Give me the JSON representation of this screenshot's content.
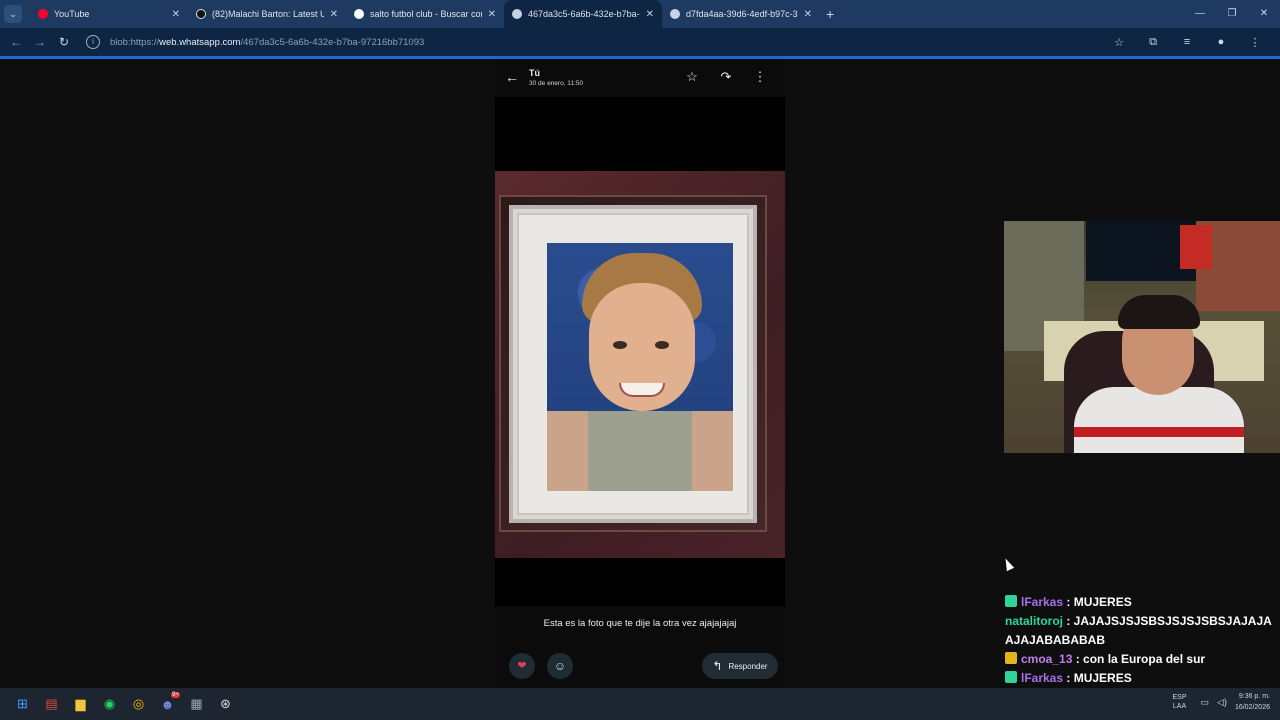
{
  "browser": {
    "tabs": [
      {
        "title": "YouTube",
        "favicon_color": "#ff0033",
        "active": false
      },
      {
        "title": "(82)Malachi Barton: Latest Upd",
        "favicon_color": "#111111",
        "active": false
      },
      {
        "title": "salto futbol club - Buscar con G",
        "favicon_color": "#ffffff",
        "active": false
      },
      {
        "title": "467da3c5-6a6b-432e-b7ba-97",
        "favicon_color": "#c7d3e3",
        "active": true
      },
      {
        "title": "d7fda4aa-39d6-4edf-b97c-37b",
        "favicon_color": "#c7d3e3",
        "active": false
      }
    ],
    "new_tab_icon": "+",
    "url_prefix": "blob:https://",
    "url_host": "web.whatsapp.com",
    "url_path": "/467da3c5-6a6b-432e-b7ba-97216bb71093"
  },
  "viewer": {
    "sender": "Tú",
    "date": "30 de enero, 11:50",
    "caption": "Esta es la foto que te dije la otra vez ajajajajaj",
    "reply_label": "Responder"
  },
  "chat": {
    "messages": [
      {
        "user": "lFarkas",
        "text": " : MUJERES",
        "badge_color": "#2fd49a"
      },
      {
        "user": "natalitoroj",
        "text": " : JAJAJSJSJSBSJSJSJSBSJAJAJAAJAJABABABAB",
        "badge_color": ""
      },
      {
        "user": "cmoa_13",
        "text": " : con la Europa del sur",
        "badge_color": "#e3b31b"
      },
      {
        "user": "lFarkas",
        "text": " : MUJERES",
        "badge_color": "#2fd49a"
      }
    ]
  },
  "taskbar": {
    "lang_top": "ESP",
    "lang_bottom": "LAA",
    "time": "9:36 p. m.",
    "date": "16/02/2026",
    "discord_badge": "9+"
  }
}
